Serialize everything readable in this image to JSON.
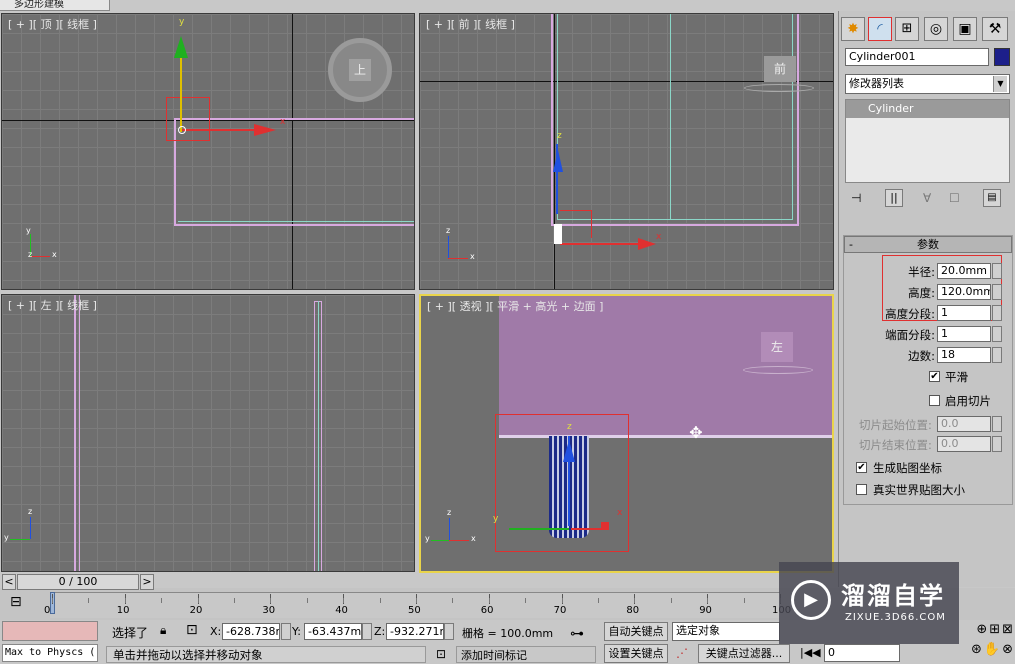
{
  "window": {
    "title_tab": "多边形建模"
  },
  "viewports": {
    "top": {
      "label": "[ + ][ 顶 ][ 线框 ]",
      "nav_text": "上",
      "axis_x": "x",
      "axis_y": "y",
      "mini_x": "x",
      "mini_y": "y",
      "mini_z": "z"
    },
    "front": {
      "label": "[ + ][ 前 ][ 线框 ]",
      "nav_text": "前",
      "axis_x": "x",
      "axis_z": "z",
      "mini_x": "x",
      "mini_z": "z"
    },
    "left": {
      "label": "[ + ][ 左 ][ 线框 ]",
      "mini_y": "y",
      "mini_z": "z"
    },
    "persp": {
      "label": "[ + ][ 透视 ][ 平滑 + 高光 + 边面 ]",
      "nav_text": "左",
      "axis_x": "x",
      "axis_y": "y",
      "axis_z": "z",
      "mini_x": "x",
      "mini_y": "y",
      "mini_z": "z"
    }
  },
  "panel": {
    "object_name": "Cylinder001",
    "object_color": "#1c1f8a",
    "modifier_list": "修改器列表",
    "stack_item": "Cylinder",
    "rollout_toggle": "-",
    "rollout_title": "参数",
    "params": [
      {
        "label": "半径:",
        "value": "20.0mm"
      },
      {
        "label": "高度:",
        "value": "120.0mm"
      },
      {
        "label": "高度分段:",
        "value": "1"
      },
      {
        "label": "端面分段:",
        "value": "1"
      },
      {
        "label": "边数:",
        "value": "18"
      }
    ],
    "smooth_label": "平滑",
    "smooth_checked": "✔",
    "slice_label": "启用切片",
    "slice_from_label": "切片起始位置:",
    "slice_from_value": "0.0",
    "slice_to_label": "切片结束位置:",
    "slice_to_value": "0.0",
    "gen_map_label": "生成贴图坐标",
    "gen_map_checked": "✔",
    "real_world_label": "真实世界贴图大小"
  },
  "timeline": {
    "frame_readout": "0 / 100",
    "prev": "<",
    "next": ">",
    "ticks": [
      "0",
      "10",
      "20",
      "30",
      "40",
      "50",
      "60",
      "70",
      "80",
      "90",
      "100"
    ]
  },
  "status": {
    "script_listener": "Max to Physcs (",
    "selection": "选择了",
    "x_label": "X:",
    "x_value": "-628.738m",
    "y_label": "Y:",
    "y_value": "-63.437mm",
    "z_label": "Z:",
    "z_value": "-932.271m",
    "grid": "栅格 = 100.0mm",
    "auto_key": "自动关键点",
    "selected_object": "选定对象",
    "set_key": "设置关键点",
    "key_filter": "关键点过滤器...",
    "frame_field": "0",
    "prompt": "单击并拖动以选择并移动对象",
    "add_time_tag": "添加时间标记"
  },
  "watermark": {
    "brand": "溜溜自学",
    "url": "ZIXUE.3D66.COM"
  },
  "colors": {
    "viewport_bg": "#6f6f6f",
    "active_border": "#e9d44a",
    "object_purple": "#a07aa8",
    "selection_red": "#e03030"
  }
}
